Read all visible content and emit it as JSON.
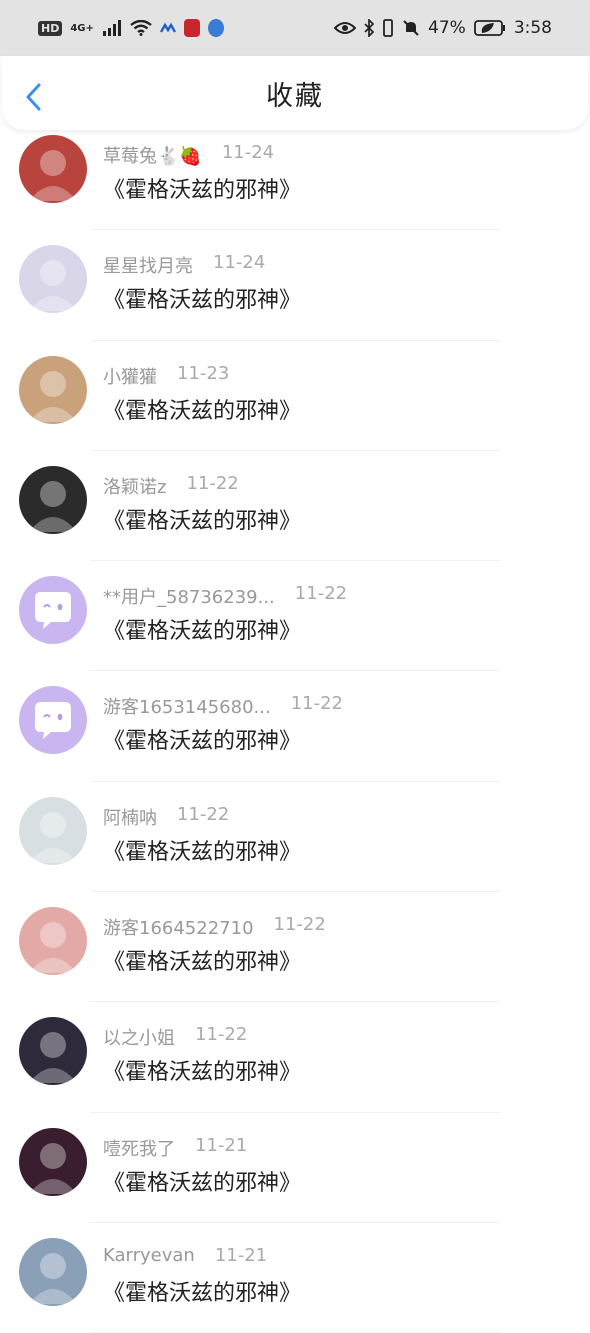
{
  "status_bar": {
    "hd": "HD",
    "net": "4G+",
    "battery_pct": "47%",
    "time": "3:58",
    "icons": [
      "signal-icon",
      "wifi-icon",
      "app-icon",
      "mic-app-icon",
      "browser-app-icon",
      "eye-icon",
      "bluetooth-icon",
      "vibrate-icon",
      "mute-icon",
      "battery-icon"
    ]
  },
  "header": {
    "title": "收藏",
    "back_icon": "chevron-left-icon"
  },
  "items": [
    {
      "user": "草莓兔🐇🍓",
      "date": "11-24",
      "book": "《霍格沃兹的邪神》",
      "avatar_color": "#b8443d"
    },
    {
      "user": "星星找月亮",
      "date": "11-24",
      "book": "《霍格沃兹的邪神》",
      "avatar_color": "#d9d6ea"
    },
    {
      "user": "小獾獾",
      "date": "11-23",
      "book": "《霍格沃兹的邪神》",
      "avatar_color": "#c9a27b"
    },
    {
      "user": "洛颖诺z",
      "date": "11-22",
      "book": "《霍格沃兹的邪神》",
      "avatar_color": "#2b2b2b"
    },
    {
      "user": "**用户_58736239...",
      "date": "11-22",
      "book": "《霍格沃兹的邪神》",
      "avatar_color": "#c9b6f0",
      "default_avatar": true
    },
    {
      "user": "游客1653145680...",
      "date": "11-22",
      "book": "《霍格沃兹的邪神》",
      "avatar_color": "#c9b6f0",
      "default_avatar": true
    },
    {
      "user": "阿楠呐",
      "date": "11-22",
      "book": "《霍格沃兹的邪神》",
      "avatar_color": "#d8dfe2"
    },
    {
      "user": "游客1664522710",
      "date": "11-22",
      "book": "《霍格沃兹的邪神》",
      "avatar_color": "#e3a9a6"
    },
    {
      "user": "以之小姐",
      "date": "11-22",
      "book": "《霍格沃兹的邪神》",
      "avatar_color": "#2e2a3b"
    },
    {
      "user": "噎死我了",
      "date": "11-21",
      "book": "《霍格沃兹的邪神》",
      "avatar_color": "#3a1e2f"
    },
    {
      "user": "Karryevan",
      "date": "11-21",
      "book": "《霍格沃兹的邪神》",
      "avatar_color": "#8aa0b8"
    }
  ]
}
